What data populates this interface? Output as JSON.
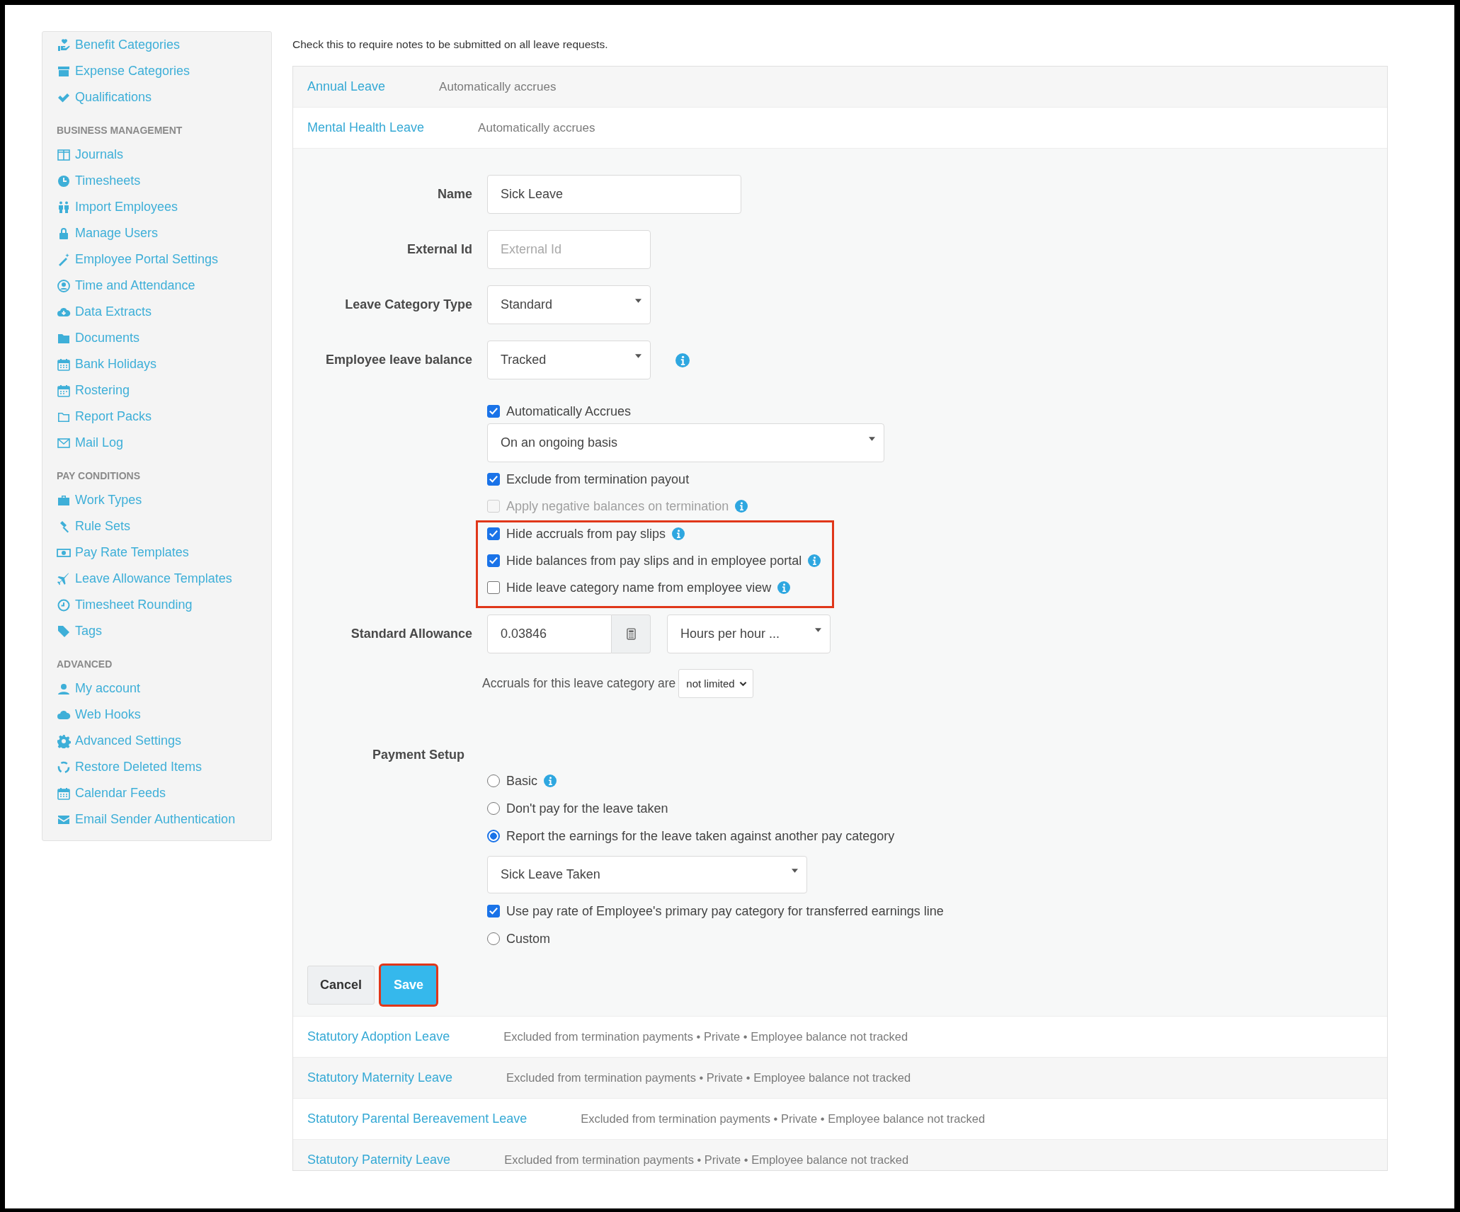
{
  "sidebar": {
    "sections": [
      {
        "items": [
          "Benefit Categories",
          "Expense Categories",
          "Qualifications"
        ]
      },
      {
        "heading": "BUSINESS MANAGEMENT",
        "items": [
          "Journals",
          "Timesheets",
          "Import Employees",
          "Manage Users",
          "Employee Portal Settings",
          "Time and Attendance",
          "Data Extracts",
          "Documents",
          "Bank Holidays",
          "Rostering",
          "Report Packs",
          "Mail Log"
        ]
      },
      {
        "heading": "PAY CONDITIONS",
        "items": [
          "Work Types",
          "Rule Sets",
          "Pay Rate Templates",
          "Leave Allowance Templates",
          "Timesheet Rounding",
          "Tags"
        ]
      },
      {
        "heading": "ADVANCED",
        "items": [
          "My account",
          "Web Hooks",
          "Advanced Settings",
          "Restore Deleted Items",
          "Calendar Feeds",
          "Email Sender Authentication"
        ]
      }
    ]
  },
  "note": "Check this to require notes to be submitted on all leave requests.",
  "leave_categories_top": [
    {
      "name": "Annual Leave",
      "description": "Automatically accrues"
    },
    {
      "name": "Mental Health Leave",
      "description": "Automatically accrues"
    }
  ],
  "form": {
    "fields": [
      {
        "kind": "text",
        "label": "Name",
        "value": "Sick Leave",
        "info": false
      },
      {
        "kind": "text",
        "label": "External Id",
        "placeholder": "External Id",
        "info": false
      },
      {
        "kind": "select",
        "label": "Leave Category Type",
        "value": "Standard",
        "info": false
      },
      {
        "kind": "select",
        "label": "Employee leave balance",
        "value": "Tracked",
        "info": true
      }
    ],
    "auto_accrues": {
      "label": "Automatically Accrues",
      "checked": true
    },
    "accrual_basis": {
      "value": "On an ongoing basis"
    },
    "options": [
      {
        "label": "Exclude from termination payout",
        "checked": true,
        "disabled": false,
        "info": false
      },
      {
        "label": "Apply negative balances on termination",
        "checked": false,
        "disabled": true,
        "info": true
      }
    ],
    "highlighted_options": [
      {
        "label": "Hide accruals from pay slips",
        "checked": true,
        "disabled": false,
        "info": true
      },
      {
        "label": "Hide balances from pay slips and in employee portal",
        "checked": true,
        "disabled": false,
        "info": true
      },
      {
        "label": "Hide leave category name from employee view",
        "checked": false,
        "disabled": false,
        "info": true
      }
    ],
    "standard_allowance": {
      "label": "Standard Allowance",
      "value": "0.03846",
      "unit": "Hours per hour ..."
    },
    "accrual_limit": {
      "text": "Accruals for this leave category are",
      "value": "not limited"
    },
    "payment_setup": {
      "label": "Payment Setup",
      "choices": [
        {
          "kind": "radio",
          "label": "Basic",
          "selected": false,
          "info": true
        },
        {
          "kind": "radio",
          "label": "Don't pay for the leave taken",
          "selected": false,
          "info": false
        },
        {
          "kind": "radio",
          "label": "Report the earnings for the leave taken against another pay category",
          "selected": true,
          "info": false
        },
        {
          "kind": "select",
          "value": "Sick Leave Taken"
        },
        {
          "kind": "checkbox",
          "label": "Use pay rate of Employee's primary pay category for transferred earnings line",
          "checked": true,
          "info": false
        },
        {
          "kind": "radio",
          "label": "Custom",
          "selected": false,
          "info": false
        }
      ]
    },
    "buttons": [
      {
        "kind": "default",
        "label": "Cancel",
        "highlighted": false
      },
      {
        "kind": "primary",
        "label": "Save",
        "highlighted": true
      }
    ]
  },
  "leave_categories_bottom": [
    {
      "name": "Statutory Adoption Leave",
      "description": "Excluded from termination payments • Private • Employee balance not tracked"
    },
    {
      "name": "Statutory Maternity Leave",
      "description": "Excluded from termination payments • Private • Employee balance not tracked"
    },
    {
      "name": "Statutory Parental Bereavement Leave",
      "description": "Excluded from termination payments • Private • Employee balance not tracked"
    },
    {
      "name": "Statutory Paternity Leave",
      "description": "Excluded from termination payments • Private • Employee balance not tracked"
    }
  ]
}
